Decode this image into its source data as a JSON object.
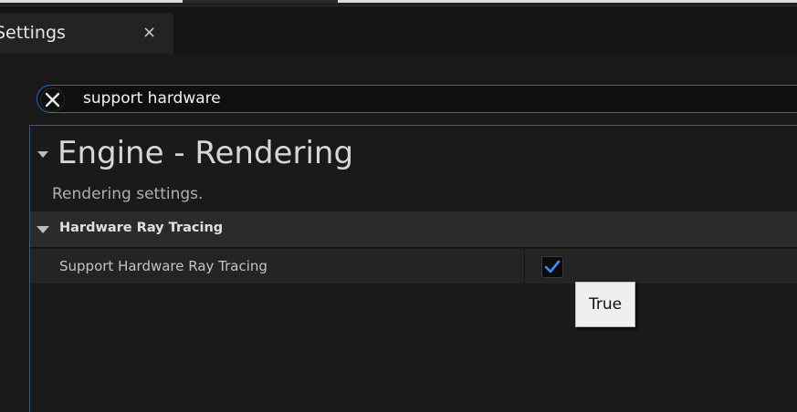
{
  "tab": {
    "title": "Settings",
    "close_glyph": "×"
  },
  "search": {
    "value": "support hardware",
    "clear_icon": "close-x-icon"
  },
  "section": {
    "title": "Engine - Rendering",
    "description": "Rendering settings."
  },
  "category": {
    "label": "Hardware Ray Tracing"
  },
  "property": {
    "name": "Support Hardware Ray Tracing",
    "checked": true
  },
  "tooltip": {
    "text": "True"
  },
  "colors": {
    "accent": "#1f6bc8",
    "check": "#3a8ff0",
    "background": "#151515"
  }
}
